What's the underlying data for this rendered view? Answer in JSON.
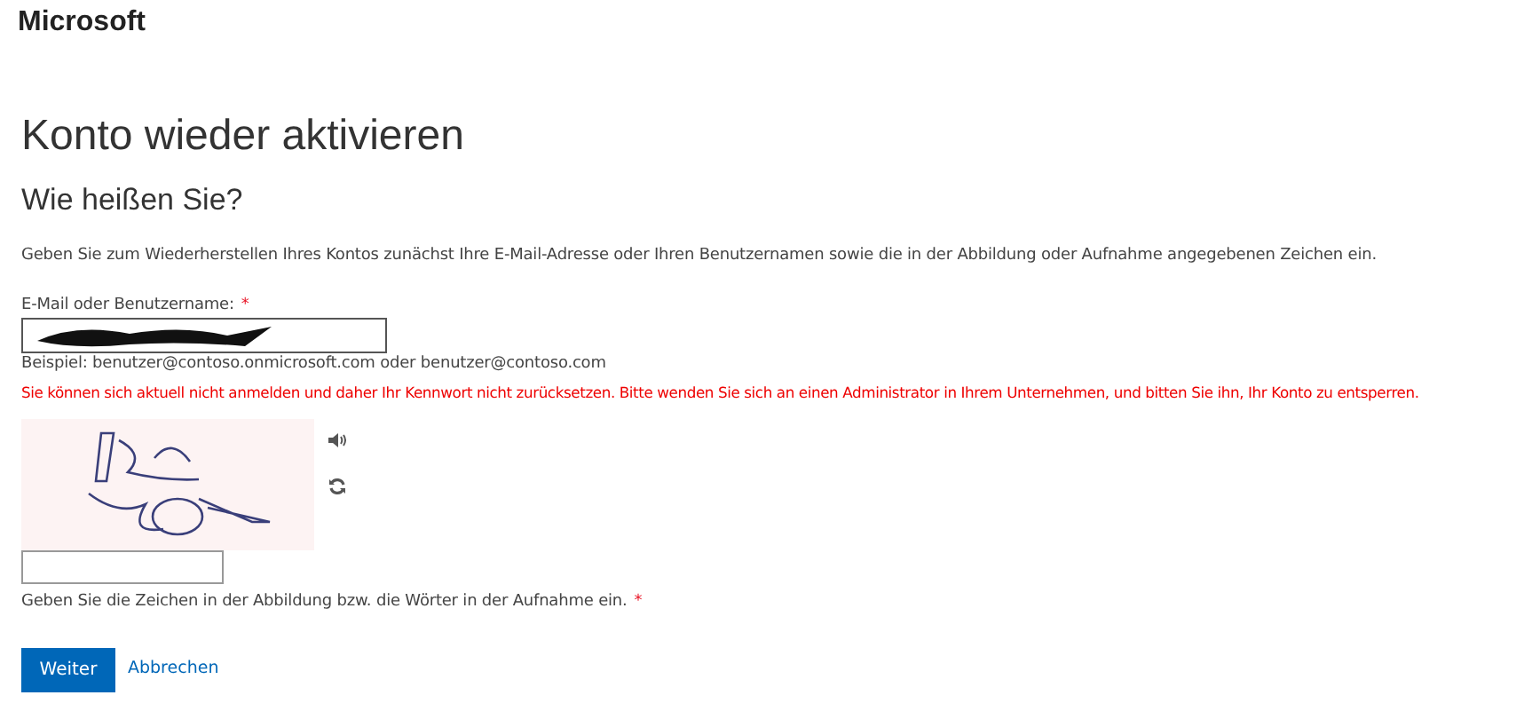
{
  "logo": "Microsoft",
  "title": "Konto wieder aktivieren",
  "subtitle": "Wie heißen Sie?",
  "intro": "Geben Sie zum Wiederherstellen Ihres Kontos zunächst Ihre E-Mail-Adresse oder Ihren Benutzernamen sowie die in der Abbildung oder Aufnahme angegebenen Zeichen ein.",
  "email_field": {
    "label": "E-Mail oder Benutzername:",
    "required_mark": "*",
    "redacted": true
  },
  "example": "Beispiel: benutzer@contoso.onmicrosoft.com oder benutzer@contoso.com",
  "error": "Sie können sich aktuell nicht anmelden und daher Ihr Kennwort nicht zurücksetzen. Bitte wenden Sie sich an einen Administrator in Ihrem Unternehmen, und bitten Sie ihn, Ihr Konto zu entsperren.",
  "captcha": {
    "kind": "picture",
    "hint": "Geben Sie die Zeichen in der Abbildung bzw. die Wörter in der Aufnahme ein.",
    "required_mark": "*"
  },
  "buttons": [
    {
      "label": "Weiter",
      "kind": "primary"
    },
    {
      "label": "Abbrechen",
      "kind": "link"
    }
  ]
}
